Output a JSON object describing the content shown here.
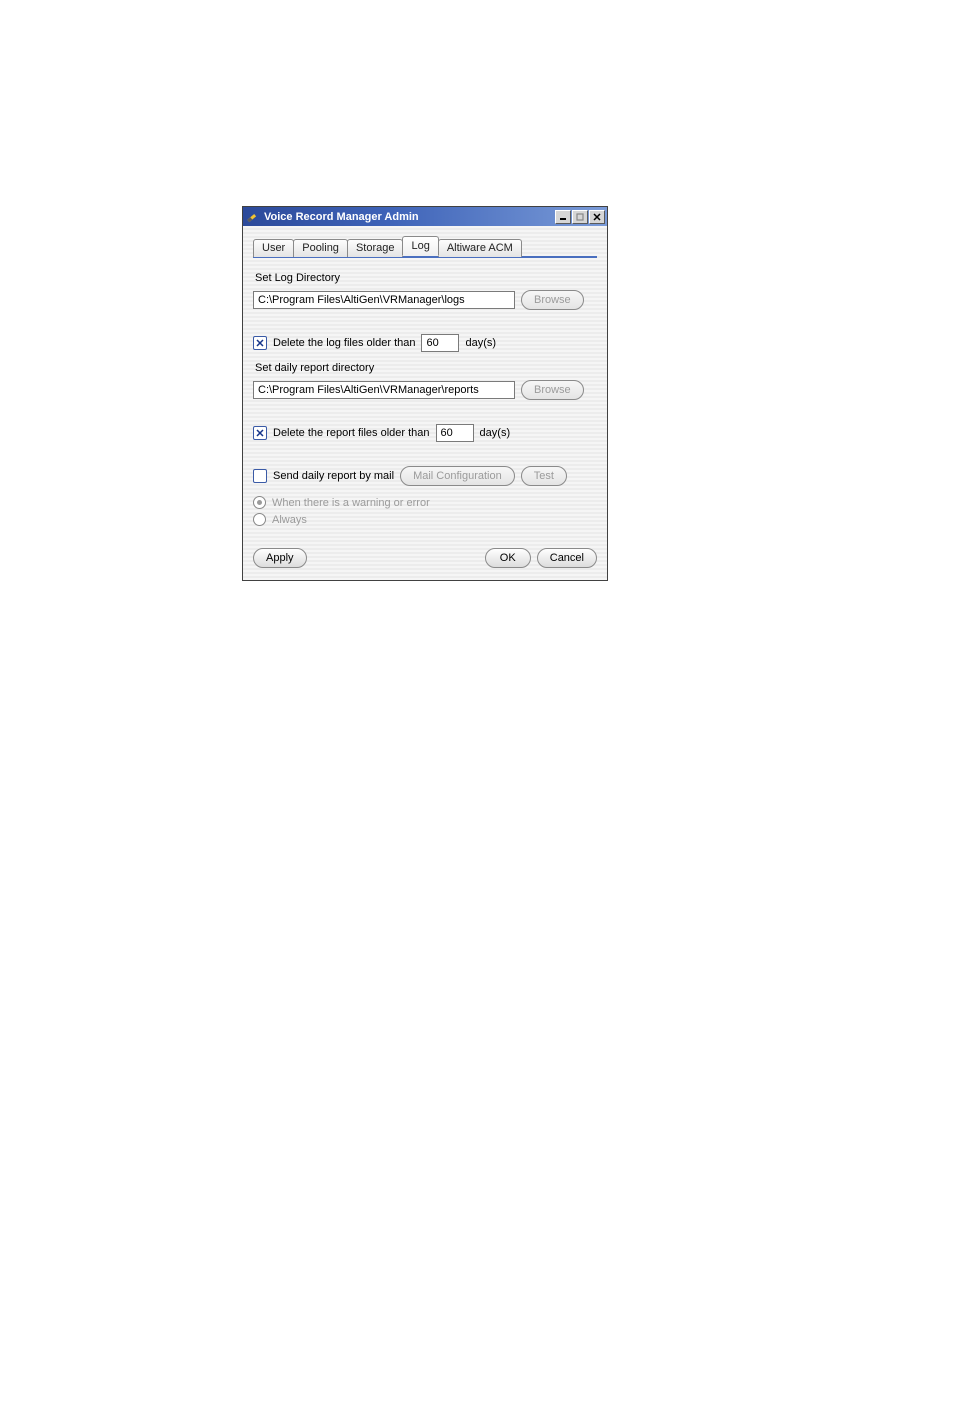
{
  "window": {
    "title": "Voice Record Manager Admin"
  },
  "tabs": [
    "User",
    "Pooling",
    "Storage",
    "Log",
    "Altiware ACM"
  ],
  "active_tab_index": 3,
  "log": {
    "set_log_dir_label": "Set Log Directory",
    "log_dir_value": "C:\\Program Files\\AltiGen\\VRManager\\logs",
    "browse_label": "Browse",
    "delete_logs_label": "Delete the log files older than",
    "delete_logs_days_value": "60",
    "days_label": "day(s)",
    "set_report_dir_label": "Set daily report directory",
    "report_dir_value": "C:\\Program Files\\AltiGen\\VRManager\\reports",
    "delete_reports_label": "Delete the report files older than",
    "delete_reports_days_value": "60",
    "send_mail_label": "Send daily report by mail",
    "mail_config_label": "Mail Configuration",
    "test_label": "Test",
    "radio_warning_label": "When there is a warning or error",
    "radio_always_label": "Always"
  },
  "buttons": {
    "apply": "Apply",
    "ok": "OK",
    "cancel": "Cancel"
  }
}
